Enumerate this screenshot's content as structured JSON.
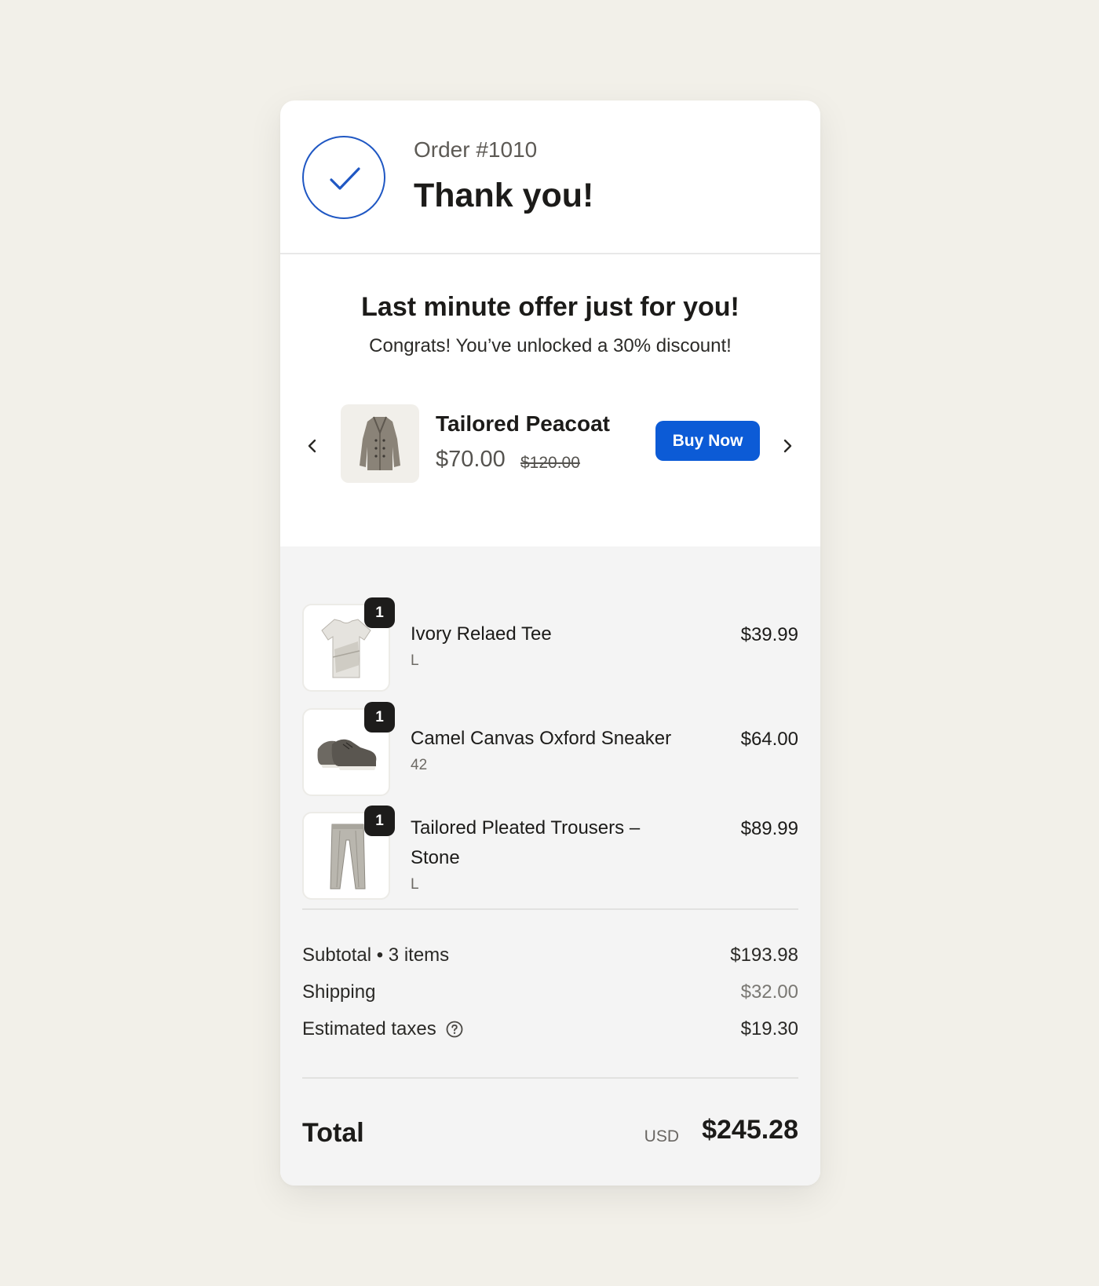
{
  "header": {
    "order_number": "Order #1010",
    "title": "Thank you!"
  },
  "offer": {
    "title": "Last minute offer just for you!",
    "subtitle": "Congrats! You’ve unlocked a 30% discount!",
    "product_name": "Tailored Peacoat",
    "price": "$70.00",
    "compare_price": "$120.00",
    "buy_label": "Buy Now",
    "icons": {
      "prev": "chevron-left-icon",
      "next": "chevron-right-icon"
    }
  },
  "line_items": [
    {
      "name": "Ivory Relaed Tee",
      "variant": "L",
      "price": "$39.99",
      "quantity": "1"
    },
    {
      "name": "Camel Canvas Oxford Sneaker",
      "variant": "42",
      "price": "$64.00",
      "quantity": "1"
    },
    {
      "name": "Tailored Pleated Trousers – Stone",
      "variant": "L",
      "price": "$89.99",
      "quantity": "1"
    }
  ],
  "costs": {
    "subtotal_label": "Subtotal • 3 items",
    "subtotal_value": "$193.98",
    "shipping_label": "Shipping",
    "shipping_value": "$32.00",
    "taxes_label": "Estimated taxes",
    "taxes_value": "$19.30"
  },
  "total": {
    "label": "Total",
    "currency": "USD",
    "value": "$245.28"
  },
  "colors": {
    "accent": "#0c5bd6",
    "check": "#1f57c3",
    "background": "#f2f0e9",
    "summary_bg": "#f4f4f4"
  }
}
